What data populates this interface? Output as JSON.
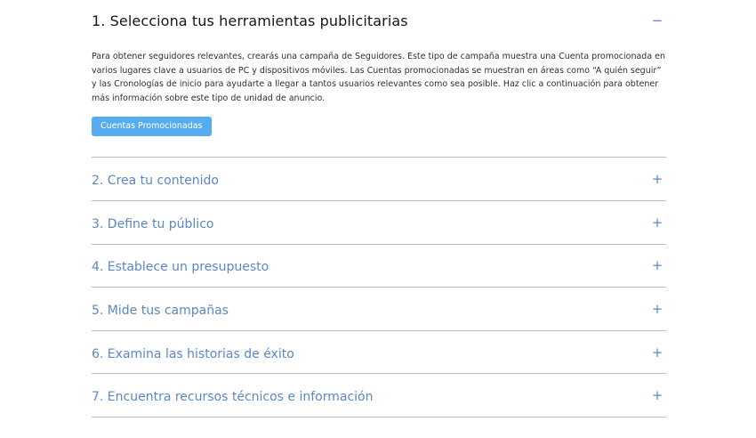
{
  "section_open": {
    "title": "1. Selecciona tus herramientas publicitarias",
    "toggle": "−",
    "body": "Para obtener seguidores relevantes, crearás una campaña de Seguidores. Este tipo de campaña muestra una Cuenta promocionada en varios lugares clave a usuarios de PC y dispositivos móviles. Las Cuentas promocionadas se muestran en áreas como “A quién seguir” y las Cronologías de inicio para ayudarte a llegar a tantos usuarios relevantes como sea posible. Haz clic a continuación para obtener más información sobre este tipo de unidad de anuncio.",
    "button_label": "Cuentas Promocionadas"
  },
  "sections": [
    {
      "title": "2. Crea tu contenido",
      "toggle": "+"
    },
    {
      "title": "3. Define tu público",
      "toggle": "+"
    },
    {
      "title": "4. Establece un presupuesto",
      "toggle": "+"
    },
    {
      "title": "5. Mide tus campañas",
      "toggle": "+"
    },
    {
      "title": "6. Examina las historias de éxito",
      "toggle": "+"
    },
    {
      "title": "7. Encuentra recursos técnicos e información",
      "toggle": "+"
    }
  ]
}
